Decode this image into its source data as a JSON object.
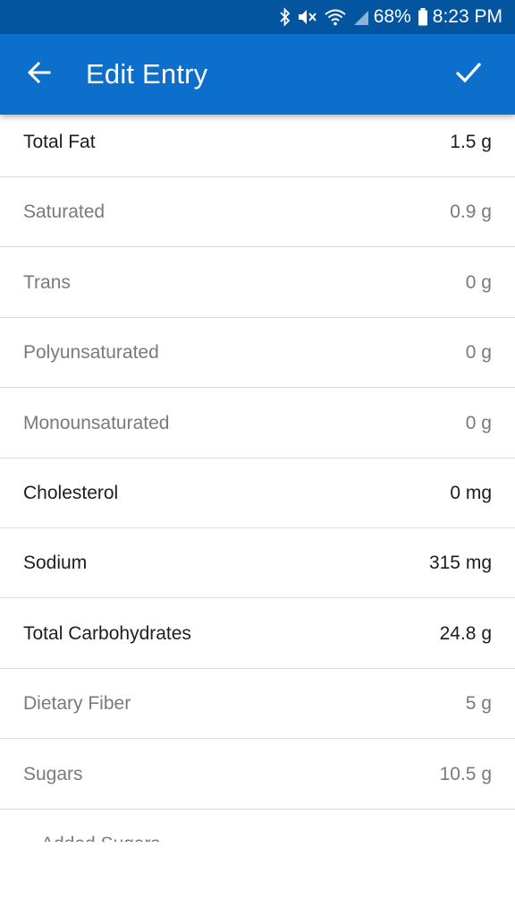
{
  "status_bar": {
    "battery": "68%",
    "time": "8:23 PM",
    "icons": [
      "bluetooth-icon",
      "mute-icon",
      "wifi-icon",
      "signal-icon",
      "battery-icon"
    ]
  },
  "app_bar": {
    "title": "Edit Entry",
    "back_icon": "arrow-left-icon",
    "save_icon": "check-icon",
    "color": "#0b6fcb",
    "status_color": "#0455a0"
  },
  "nutrients": [
    {
      "label": "Total Fat",
      "value": "1.5 g",
      "style": "primary"
    },
    {
      "label": "Saturated",
      "value": "0.9 g",
      "style": "secondary"
    },
    {
      "label": "Trans",
      "value": "0 g",
      "style": "secondary"
    },
    {
      "label": "Polyunsaturated",
      "value": "0 g",
      "style": "secondary"
    },
    {
      "label": "Monounsaturated",
      "value": "0 g",
      "style": "secondary"
    },
    {
      "label": "Cholesterol",
      "value": "0 mg",
      "style": "primary"
    },
    {
      "label": "Sodium",
      "value": "315 mg",
      "style": "primary"
    },
    {
      "label": "Total Carbohydrates",
      "value": "24.8 g",
      "style": "primary"
    },
    {
      "label": "Dietary Fiber",
      "value": "5 g",
      "style": "secondary"
    },
    {
      "label": "Sugars",
      "value": "10.5 g",
      "style": "secondary"
    },
    {
      "label": "Added Sugars",
      "value": "",
      "style": "secondary sub"
    }
  ]
}
